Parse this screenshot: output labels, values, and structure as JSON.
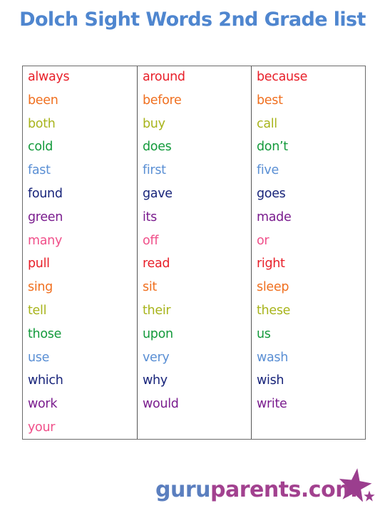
{
  "title": "Dolch Sight Words 2nd Grade list",
  "colors": {
    "title": "#4f86cf",
    "row_palette": [
      "#e8202a",
      "#f07020",
      "#a8b41c",
      "#149a3c",
      "#5a8fd4",
      "#18247a",
      "#7a1c8e",
      "#f0508a"
    ]
  },
  "columns": [
    {
      "words": [
        "always",
        "been",
        "both",
        "cold",
        "fast",
        "found",
        "green",
        "many",
        "pull",
        "sing",
        "tell",
        "those",
        "use",
        "which",
        "work",
        "your"
      ]
    },
    {
      "words": [
        "around",
        "before",
        "buy",
        "does",
        "first",
        "gave",
        "its",
        "off",
        "read",
        "sit",
        "their",
        "upon",
        "very",
        "why",
        "would"
      ]
    },
    {
      "words": [
        "because",
        "best",
        "call",
        "don’t",
        "five",
        "goes",
        "made",
        "or",
        "right",
        "sleep",
        "these",
        "us",
        "wash",
        "wish",
        "write"
      ]
    }
  ],
  "logo": {
    "part1": "guru",
    "part2": "parents.com",
    "icon": "star-icon",
    "colors": {
      "part1": "#5b7fbf",
      "part2": "#a2418f"
    }
  }
}
